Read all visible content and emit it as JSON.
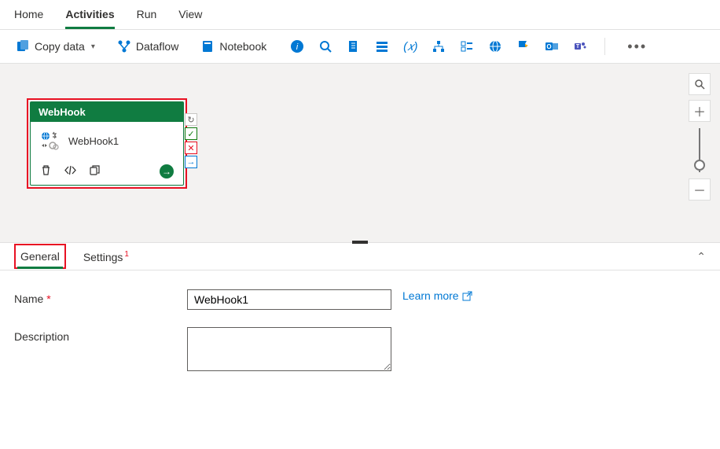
{
  "topTabs": {
    "home": "Home",
    "activities": "Activities",
    "run": "Run",
    "view": "View",
    "active": "activities"
  },
  "toolbar": {
    "copyData": "Copy data",
    "dataflow": "Dataflow",
    "notebook": "Notebook"
  },
  "node": {
    "type": "WebHook",
    "name": "WebHook1"
  },
  "panelTabs": {
    "general": "General",
    "settings": "Settings",
    "settingsBadge": "1"
  },
  "form": {
    "nameLabel": "Name",
    "nameValue": "WebHook1",
    "descLabel": "Description",
    "descValue": "",
    "learnMore": "Learn more"
  }
}
